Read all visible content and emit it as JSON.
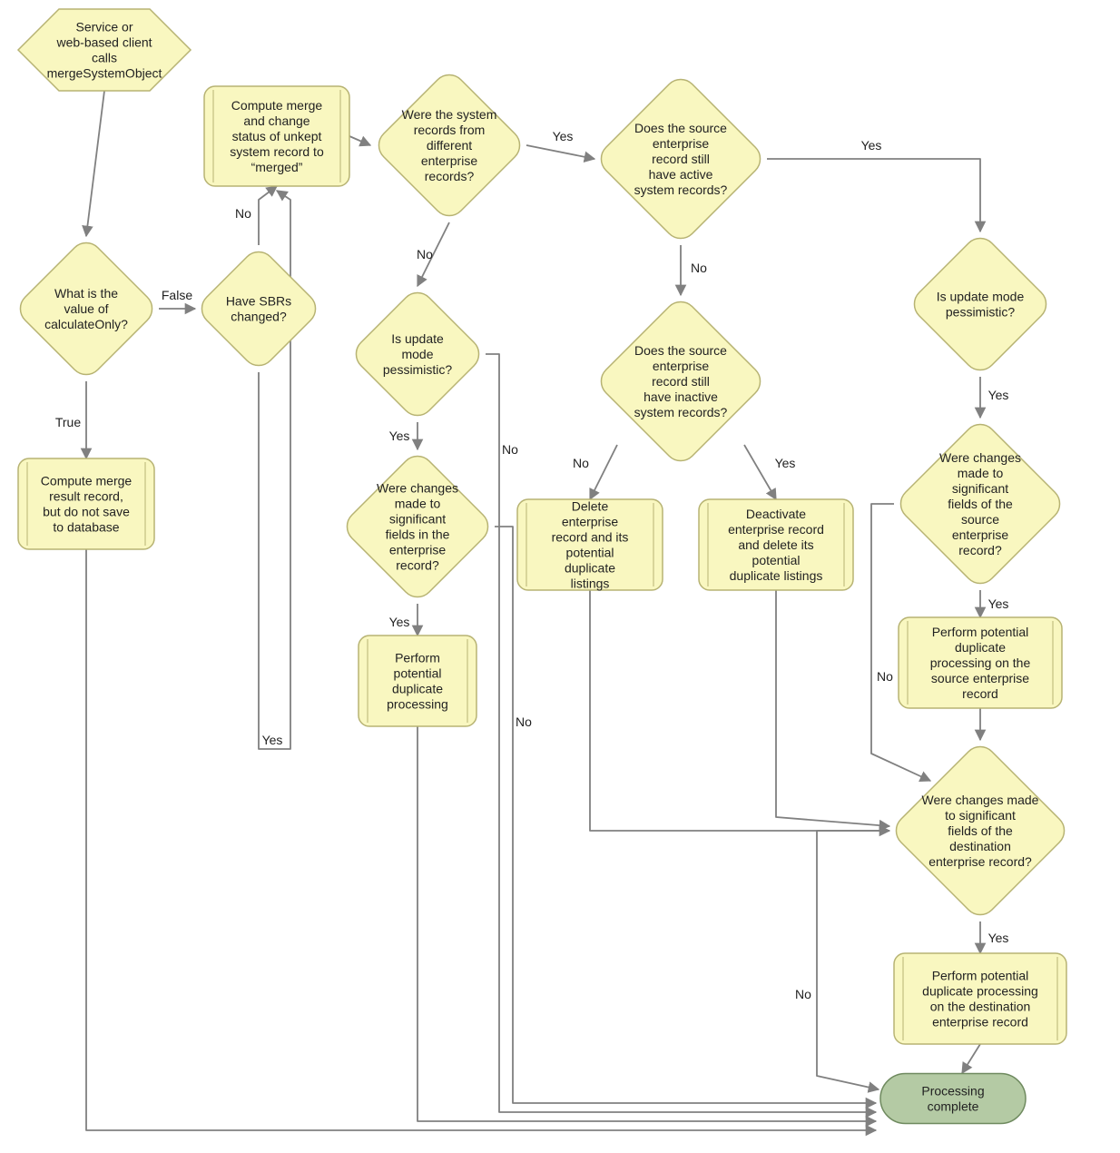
{
  "nodes": {
    "start": {
      "text": "Service or web-based client calls mergeSystemObject"
    },
    "calcOnly": {
      "text": "What is the value of calculateOnly?"
    },
    "computeNoSave": {
      "text": "Compute merge result record, but do not save to database"
    },
    "sbrs": {
      "text": "Have SBRs changed?"
    },
    "computeMerge": {
      "text": "Compute merge and change status of unkept system record to “merged”"
    },
    "diffEnt": {
      "text": "Were the system records from different enterprise records?"
    },
    "updPess1": {
      "text": "Is update mode pessimistic?"
    },
    "sigFields1": {
      "text": "Were changes made to significant fields in the enterprise record?"
    },
    "potDup1": {
      "text": "Perform potential duplicate processing"
    },
    "activeSys": {
      "text": "Does the source enterprise record still have active system records?"
    },
    "inactiveSys": {
      "text": "Does the source enterprise record still have inactive system records?"
    },
    "deleteEnt": {
      "text": "Delete enterprise record and its potential duplicate listings"
    },
    "deactEnt": {
      "text": "Deactivate enterprise record and delete its potential duplicate listings"
    },
    "updPess2": {
      "text": "Is update mode pessimistic?"
    },
    "sigSrc": {
      "text": "Were changes made to significant fields of the source enterprise record?"
    },
    "potDupSrc": {
      "text": "Perform potential duplicate processing on the source enterprise record"
    },
    "sigDest": {
      "text": "Were changes made to significant fields of the destination enterprise record?"
    },
    "potDupDest": {
      "text": "Perform potential duplicate processing on the destination enterprise record"
    },
    "done": {
      "text": "Processing complete"
    }
  },
  "edgeLabels": {
    "true": "True",
    "false": "False",
    "yes": "Yes",
    "no": "No"
  },
  "colors": {
    "nodeFill": "#f9f7c0",
    "nodeStroke": "#b7b373",
    "doneFill": "#b4caa4",
    "doneStroke": "#6f8a5f",
    "edge": "#808080",
    "text": "#222222"
  },
  "chart_data": {
    "type": "flowchart",
    "nodes": [
      {
        "id": "start",
        "shape": "hexagon",
        "label": "Service or web-based client calls mergeSystemObject"
      },
      {
        "id": "calcOnly",
        "shape": "decision",
        "label": "What is the value of calculateOnly?"
      },
      {
        "id": "computeNoSave",
        "shape": "process",
        "label": "Compute merge result record, but do not save to database"
      },
      {
        "id": "sbrs",
        "shape": "decision",
        "label": "Have SBRs changed?"
      },
      {
        "id": "computeMerge",
        "shape": "process",
        "label": "Compute merge and change status of unkept system record to “merged”"
      },
      {
        "id": "diffEnt",
        "shape": "decision",
        "label": "Were the system records from different enterprise records?"
      },
      {
        "id": "updPess1",
        "shape": "decision",
        "label": "Is update mode pessimistic?"
      },
      {
        "id": "sigFields1",
        "shape": "decision",
        "label": "Were changes made to significant fields in the enterprise record?"
      },
      {
        "id": "potDup1",
        "shape": "process",
        "label": "Perform potential duplicate processing"
      },
      {
        "id": "activeSys",
        "shape": "decision",
        "label": "Does the source enterprise record still have active system records?"
      },
      {
        "id": "inactiveSys",
        "shape": "decision",
        "label": "Does the source enterprise record still have inactive system records?"
      },
      {
        "id": "deleteEnt",
        "shape": "process",
        "label": "Delete enterprise record and its potential duplicate listings"
      },
      {
        "id": "deactEnt",
        "shape": "process",
        "label": "Deactivate enterprise record and delete its potential duplicate listings"
      },
      {
        "id": "updPess2",
        "shape": "decision",
        "label": "Is update mode pessimistic?"
      },
      {
        "id": "sigSrc",
        "shape": "decision",
        "label": "Were changes made to significant fields of the source enterprise record?"
      },
      {
        "id": "potDupSrc",
        "shape": "process",
        "label": "Perform potential duplicate processing on the source enterprise record"
      },
      {
        "id": "sigDest",
        "shape": "decision",
        "label": "Were changes made to significant fields of the destination enterprise record?"
      },
      {
        "id": "potDupDest",
        "shape": "process",
        "label": "Perform potential duplicate processing on the destination enterprise record"
      },
      {
        "id": "done",
        "shape": "terminator",
        "label": "Processing complete"
      }
    ],
    "edges": [
      {
        "from": "start",
        "to": "calcOnly",
        "label": ""
      },
      {
        "from": "calcOnly",
        "to": "computeNoSave",
        "label": "True"
      },
      {
        "from": "calcOnly",
        "to": "sbrs",
        "label": "False"
      },
      {
        "from": "sbrs",
        "to": "computeMerge",
        "label": "No"
      },
      {
        "from": "sbrs",
        "to": "computeMerge",
        "label": "Yes"
      },
      {
        "from": "computeMerge",
        "to": "diffEnt",
        "label": ""
      },
      {
        "from": "diffEnt",
        "to": "updPess1",
        "label": "No"
      },
      {
        "from": "diffEnt",
        "to": "activeSys",
        "label": "Yes"
      },
      {
        "from": "updPess1",
        "to": "sigFields1",
        "label": "Yes"
      },
      {
        "from": "updPess1",
        "to": "done",
        "label": "No"
      },
      {
        "from": "sigFields1",
        "to": "potDup1",
        "label": "Yes"
      },
      {
        "from": "sigFields1",
        "to": "done",
        "label": "No"
      },
      {
        "from": "potDup1",
        "to": "done",
        "label": ""
      },
      {
        "from": "activeSys",
        "to": "updPess2",
        "label": "Yes"
      },
      {
        "from": "activeSys",
        "to": "inactiveSys",
        "label": "No"
      },
      {
        "from": "inactiveSys",
        "to": "deleteEnt",
        "label": "No"
      },
      {
        "from": "inactiveSys",
        "to": "deactEnt",
        "label": "Yes"
      },
      {
        "from": "deleteEnt",
        "to": "sigDest",
        "label": ""
      },
      {
        "from": "deactEnt",
        "to": "sigDest",
        "label": ""
      },
      {
        "from": "updPess2",
        "to": "sigSrc",
        "label": "Yes"
      },
      {
        "from": "sigSrc",
        "to": "potDupSrc",
        "label": "Yes"
      },
      {
        "from": "sigSrc",
        "to": "sigDest",
        "label": "No"
      },
      {
        "from": "potDupSrc",
        "to": "sigDest",
        "label": ""
      },
      {
        "from": "sigDest",
        "to": "potDupDest",
        "label": "Yes"
      },
      {
        "from": "sigDest",
        "to": "done",
        "label": "No"
      },
      {
        "from": "potDupDest",
        "to": "done",
        "label": ""
      },
      {
        "from": "computeNoSave",
        "to": "done",
        "label": ""
      }
    ]
  }
}
